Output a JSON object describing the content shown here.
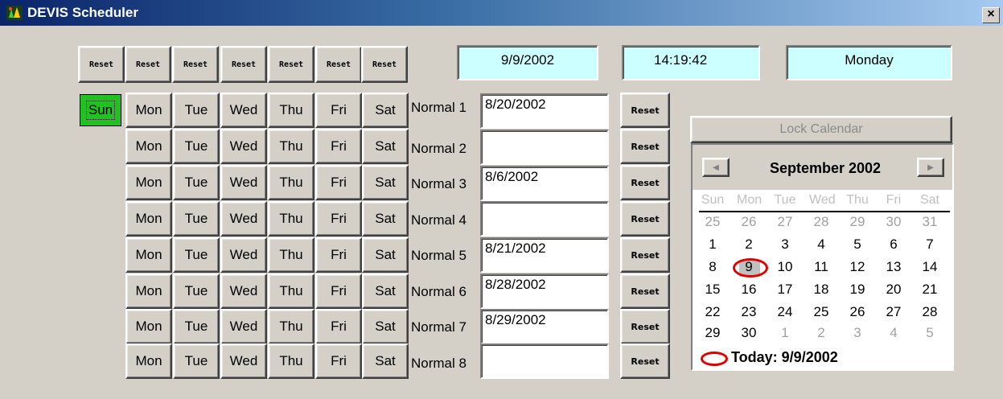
{
  "window": {
    "title": "DEVIS Scheduler",
    "close_label": "×"
  },
  "top_reset_buttons": [
    "Reset",
    "Reset",
    "Reset",
    "Reset",
    "Reset",
    "Reset",
    "Reset"
  ],
  "info": {
    "date": "9/9/2002",
    "time": "14:19:42",
    "weekday": "Monday"
  },
  "day_headers": [
    "Sun",
    "Mon",
    "Tue",
    "Wed",
    "Thu",
    "Fri",
    "Sat"
  ],
  "rows": [
    {
      "label": "Normal 1",
      "date": "8/20/2002",
      "reset": "Reset"
    },
    {
      "label": "Normal 2",
      "date": "",
      "reset": "Reset"
    },
    {
      "label": "Normal 3",
      "date": "8/6/2002",
      "reset": "Reset"
    },
    {
      "label": "Normal 4",
      "date": "",
      "reset": "Reset"
    },
    {
      "label": "Normal 5",
      "date": "8/21/2002",
      "reset": "Reset"
    },
    {
      "label": "Normal 6",
      "date": "8/28/2002",
      "reset": "Reset"
    },
    {
      "label": "Normal 7",
      "date": "8/29/2002",
      "reset": "Reset"
    },
    {
      "label": "Normal 8",
      "date": "",
      "reset": "Reset"
    }
  ],
  "calendar": {
    "lock_label": "Lock Calendar",
    "month_title": "September 2002",
    "prev_icon": "left-arrow-icon",
    "next_icon": "right-arrow-icon",
    "weekdays": [
      "Sun",
      "Mon",
      "Tue",
      "Wed",
      "Thu",
      "Fri",
      "Sat"
    ],
    "weeks": [
      [
        "25",
        "26",
        "27",
        "28",
        "29",
        "30",
        "31"
      ],
      [
        "1",
        "2",
        "3",
        "4",
        "5",
        "6",
        "7"
      ],
      [
        "8",
        "9",
        "10",
        "11",
        "12",
        "13",
        "14"
      ],
      [
        "15",
        "16",
        "17",
        "18",
        "19",
        "20",
        "21"
      ],
      [
        "22",
        "23",
        "24",
        "25",
        "26",
        "27",
        "28"
      ],
      [
        "29",
        "30",
        "1",
        "2",
        "3",
        "4",
        "5"
      ]
    ],
    "selected_day": "9",
    "today_label": "Today: 9/9/2002"
  },
  "colors": {
    "active_day": "#22c122",
    "info_box": "#ccffff",
    "today_circle": "#e00000"
  }
}
